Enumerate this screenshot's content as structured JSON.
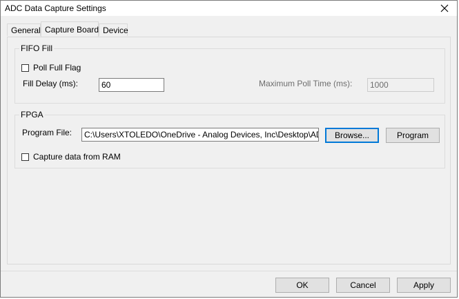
{
  "window": {
    "title": "ADC Data Capture Settings"
  },
  "tabs": [
    {
      "label": "General",
      "active": false
    },
    {
      "label": "Capture Board",
      "active": true
    },
    {
      "label": "Device",
      "active": false
    }
  ],
  "fifo": {
    "group_label": "FIFO Fill",
    "poll_full_flag_label": "Poll Full Flag",
    "poll_full_flag_checked": false,
    "fill_delay_label": "Fill Delay (ms):",
    "fill_delay_value": "60",
    "max_poll_label": "Maximum Poll Time (ms):",
    "max_poll_value": "1000"
  },
  "fpga": {
    "group_label": "FPGA",
    "program_file_label": "Program File:",
    "program_file_value": "C:\\Users\\XTOLEDO\\OneDrive - Analog Devices, Inc\\Desktop\\ADC_P",
    "browse_label": "Browse...",
    "program_label": "Program",
    "capture_ram_label": "Capture data from RAM",
    "capture_ram_checked": false
  },
  "footer": {
    "ok_label": "OK",
    "cancel_label": "Cancel",
    "apply_label": "Apply"
  }
}
